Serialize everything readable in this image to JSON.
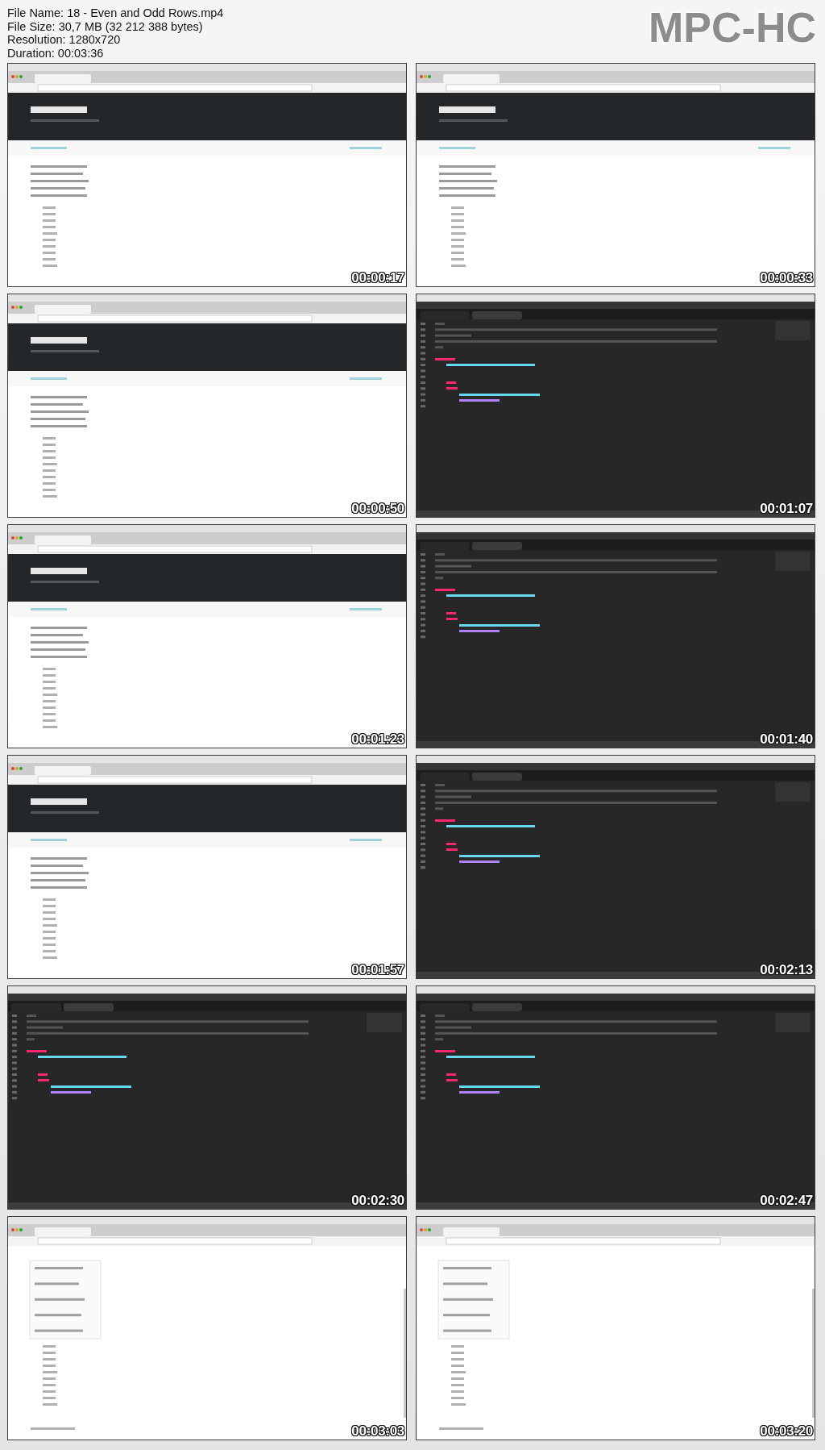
{
  "info": [
    "File Name: 18 - Even and Odd Rows.mp4",
    "File Size: 30,7 MB (32 212 388 bytes)",
    "Resolution: 1280x720",
    "Duration: 00:03:36"
  ],
  "logo": "MPC-HC",
  "thumbs": [
    {
      "kind": "browser",
      "time": "00:00:17"
    },
    {
      "kind": "browser",
      "time": "00:00:33"
    },
    {
      "kind": "browser",
      "time": "00:00:50"
    },
    {
      "kind": "editor",
      "time": "00:01:07"
    },
    {
      "kind": "browser",
      "time": "00:01:23"
    },
    {
      "kind": "editor",
      "time": "00:01:40"
    },
    {
      "kind": "browser",
      "time": "00:01:57"
    },
    {
      "kind": "editor",
      "time": "00:02:13"
    },
    {
      "kind": "editor",
      "time": "00:02:30"
    },
    {
      "kind": "editor",
      "time": "00:02:47"
    },
    {
      "kind": "page",
      "time": "00:03:03"
    },
    {
      "kind": "page",
      "time": "00:03:20"
    }
  ]
}
